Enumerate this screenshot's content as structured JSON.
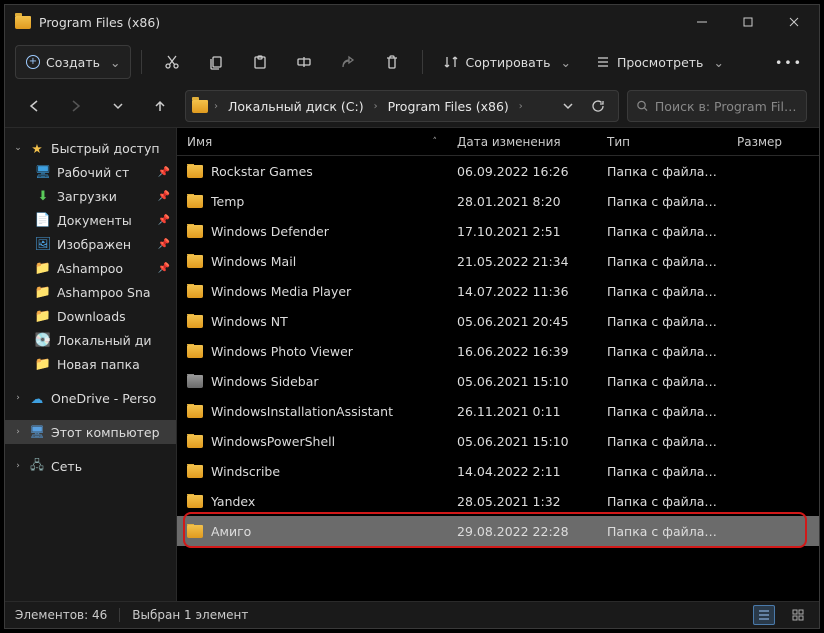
{
  "title": "Program Files (x86)",
  "toolbar": {
    "create_label": "Создать",
    "sort_label": "Сортировать",
    "view_label": "Просмотреть"
  },
  "breadcrumbs": [
    {
      "label": "Локальный диск (C:)"
    },
    {
      "label": "Program Files (x86)"
    }
  ],
  "search": {
    "placeholder": "Поиск в: Program Files..."
  },
  "sidebar": {
    "quick_access": "Быстрый доступ",
    "items": [
      {
        "label": "Рабочий ст",
        "pin": true
      },
      {
        "label": "Загрузки",
        "pin": true
      },
      {
        "label": "Документы",
        "pin": true
      },
      {
        "label": "Изображен",
        "pin": true
      },
      {
        "label": "Ashampoo",
        "pin": true
      },
      {
        "label": "Ashampoo Sna",
        "pin": false
      },
      {
        "label": "Downloads",
        "pin": false
      },
      {
        "label": "Локальный ди",
        "pin": false
      },
      {
        "label": "Новая папка",
        "pin": false
      }
    ],
    "onedrive": "OneDrive - Perso",
    "this_pc": "Этот компьютер",
    "network": "Сеть"
  },
  "columns": {
    "name": "Имя",
    "date": "Дата изменения",
    "type": "Тип",
    "size": "Размер"
  },
  "rows": [
    {
      "name": "Rockstar Games",
      "date": "06.09.2022 16:26",
      "type": "Папка с файлами"
    },
    {
      "name": "Temp",
      "date": "28.01.2021 8:20",
      "type": "Папка с файлами"
    },
    {
      "name": "Windows Defender",
      "date": "17.10.2021 2:51",
      "type": "Папка с файлами"
    },
    {
      "name": "Windows Mail",
      "date": "21.05.2022 21:34",
      "type": "Папка с файлами"
    },
    {
      "name": "Windows Media Player",
      "date": "14.07.2022 11:36",
      "type": "Папка с файлами"
    },
    {
      "name": "Windows NT",
      "date": "05.06.2021 20:45",
      "type": "Папка с файлами"
    },
    {
      "name": "Windows Photo Viewer",
      "date": "16.06.2022 16:39",
      "type": "Папка с файлами"
    },
    {
      "name": "Windows Sidebar",
      "date": "05.06.2021 15:10",
      "type": "Папка с файлами",
      "grey": true
    },
    {
      "name": "WindowsInstallationAssistant",
      "date": "26.11.2021 0:11",
      "type": "Папка с файлами"
    },
    {
      "name": "WindowsPowerShell",
      "date": "05.06.2021 15:10",
      "type": "Папка с файлами"
    },
    {
      "name": "Windscribe",
      "date": "14.04.2022 2:11",
      "type": "Папка с файлами"
    },
    {
      "name": "Yandex",
      "date": "28.05.2021 1:32",
      "type": "Папка с файлами"
    },
    {
      "name": "Амиго",
      "date": "29.08.2022 22:28",
      "type": "Папка с файлами",
      "selected": true,
      "highlight": true
    }
  ],
  "status": {
    "count_label": "Элементов: 46",
    "selected_label": "Выбран 1 элемент"
  }
}
